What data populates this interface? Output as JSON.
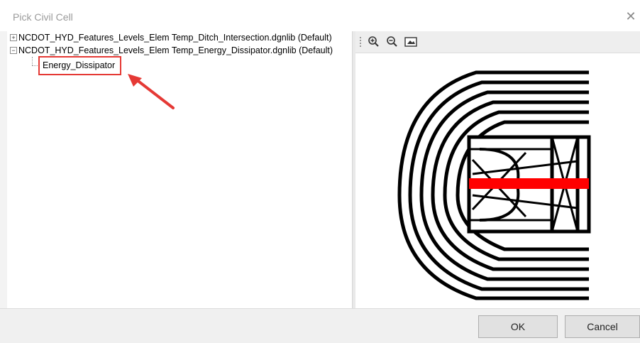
{
  "dialog": {
    "title": "Pick Civil Cell",
    "close_glyph": "✕"
  },
  "tree": {
    "items": [
      {
        "label": "NCDOT_HYD_Features_Levels_Elem Temp_Ditch_Intersection.dgnlib (Default)",
        "expander": "+",
        "expanded": false
      },
      {
        "label": "NCDOT_HYD_Features_Levels_Elem Temp_Energy_Dissipator.dgnlib (Default)",
        "expander": "−",
        "expanded": true,
        "children": [
          {
            "label": "Energy_Dissipator",
            "selected": true
          }
        ]
      }
    ]
  },
  "toolbar": {
    "icons": [
      "zoom-in-icon",
      "zoom-out-icon",
      "fit-view-icon"
    ]
  },
  "annotation": {
    "highlight_color": "#e53935"
  },
  "preview": {
    "cell_name": "Energy_Dissipator",
    "accent_color": "#ff0000"
  },
  "buttons": {
    "ok_label": "OK",
    "cancel_label": "Cancel"
  }
}
